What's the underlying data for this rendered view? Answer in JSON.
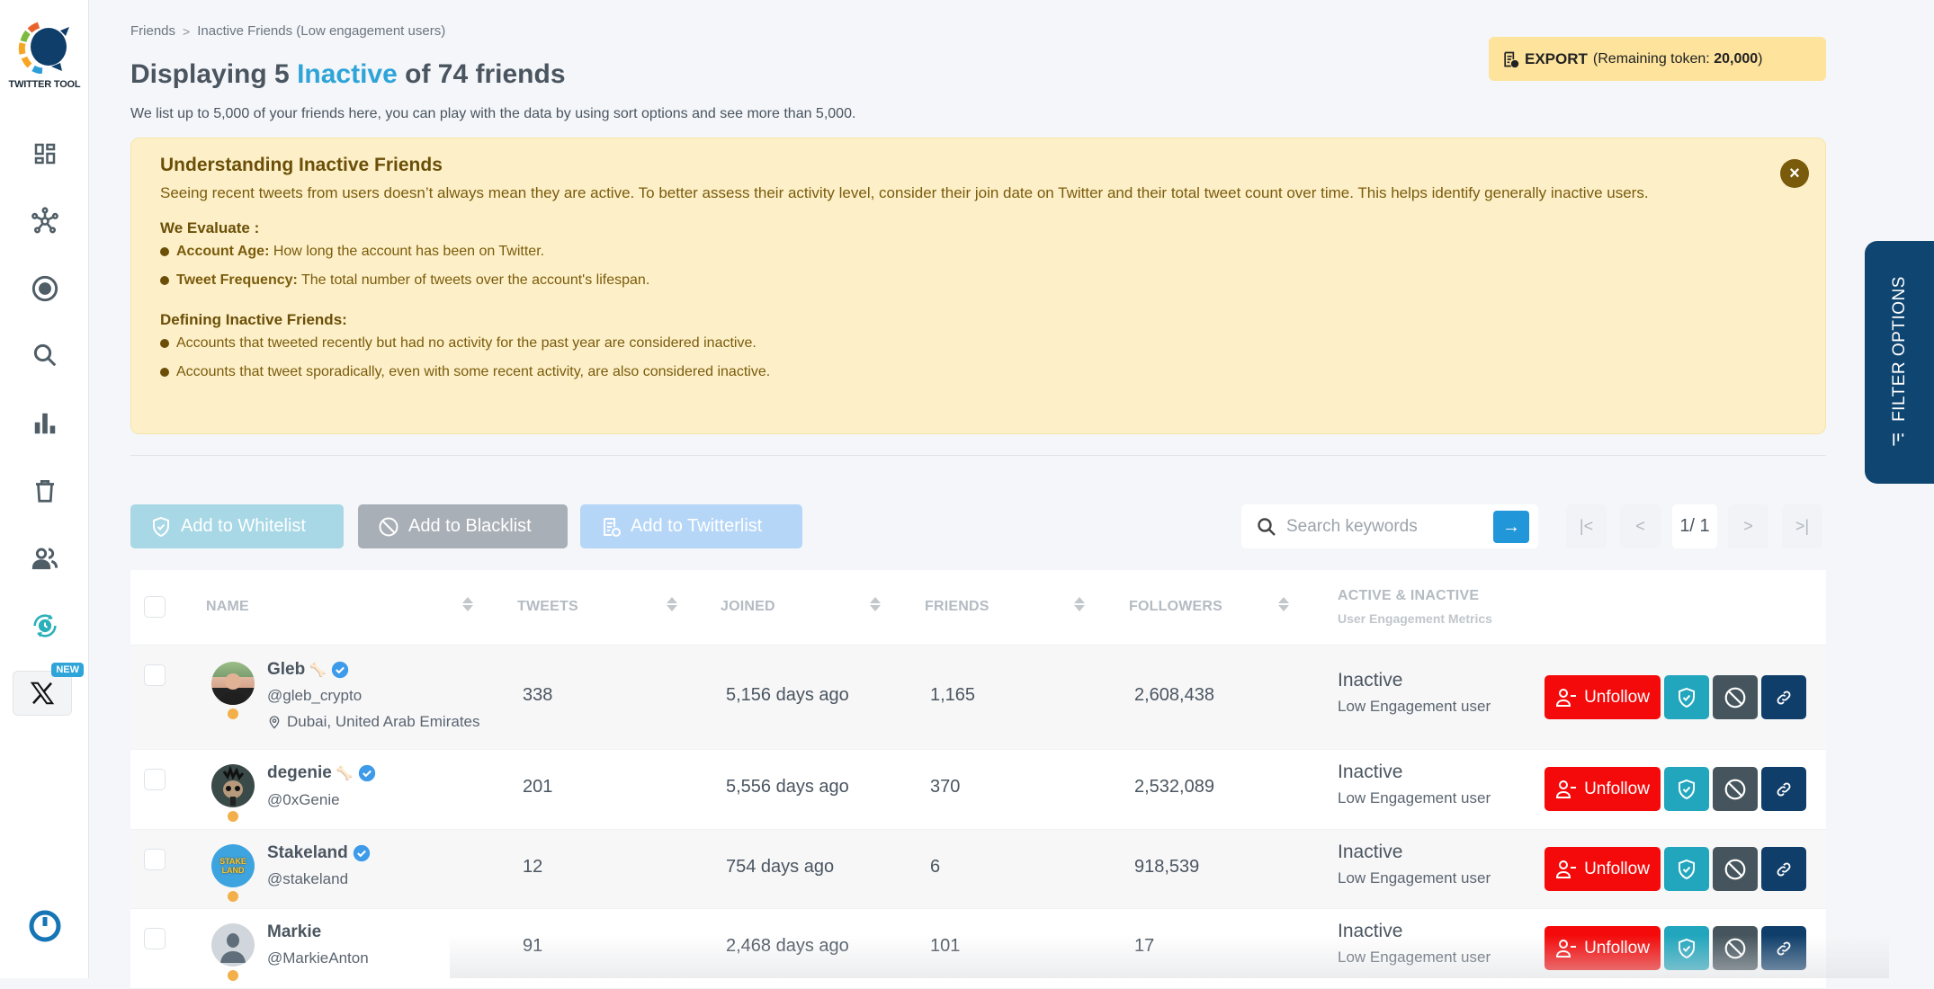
{
  "app": {
    "logo_text": "TWITTER TOOL",
    "new_badge": "NEW"
  },
  "sidebar": {
    "items": [
      {
        "name": "dashboard",
        "icon": "dashboard-icon"
      },
      {
        "name": "network",
        "icon": "network-icon"
      },
      {
        "name": "target",
        "icon": "target-icon"
      },
      {
        "name": "search",
        "icon": "search-icon"
      },
      {
        "name": "analytics",
        "icon": "bar-chart-icon"
      },
      {
        "name": "delete",
        "icon": "trash-icon"
      },
      {
        "name": "friends",
        "icon": "users-icon",
        "active": true
      },
      {
        "name": "scheduler",
        "icon": "sync-clock-icon"
      },
      {
        "name": "x",
        "icon": "x-logo-icon"
      }
    ]
  },
  "breadcrumb": {
    "items": [
      "Friends",
      "Inactive Friends (Low engagement users)"
    ],
    "separator": ">"
  },
  "header": {
    "title_prefix": "Displaying 5 ",
    "title_accent": "Inactive",
    "title_suffix": " of 74 friends",
    "subtitle": "We list up to 5,000 of your friends here, you can play with the data by using sort options and see more than 5,000.",
    "accent_color": "#2ea4d8"
  },
  "export": {
    "label": "EXPORT",
    "remaining_prefix": "(Remaining token: ",
    "remaining_value": "20,000",
    "remaining_suffix": ")"
  },
  "info": {
    "title": "Understanding Inactive Friends",
    "body": "Seeing recent tweets from users doesn’t always mean they are active. To better assess their activity level, consider their join date on Twitter and their total tweet count over time. This helps identify generally inactive users.",
    "evaluate_heading": "We Evaluate :",
    "evaluate_items": [
      {
        "label": "Account Age:",
        "text": " How long the account has been on Twitter."
      },
      {
        "label": "Tweet Frequency:",
        "text": " The total number of tweets over the account's lifespan."
      }
    ],
    "defining_heading": "Defining Inactive Friends:",
    "defining_items": [
      "Accounts that tweeted recently but had no activity for the past year are considered inactive.",
      "Accounts that tweet sporadically, even with some recent activity, are also considered inactive."
    ],
    "close_label": "×"
  },
  "bulk_actions": {
    "whitelist": "Add to Whitelist",
    "blacklist": "Add to Blacklist",
    "twitterlist": "Add to Twitterlist"
  },
  "search": {
    "placeholder": "Search keywords",
    "value": "",
    "go_label": "→"
  },
  "pagination": {
    "first": "|<",
    "prev": "<",
    "current": "1/ 1",
    "next": ">",
    "last": ">|"
  },
  "table": {
    "columns": {
      "name": "NAME",
      "tweets": "TWEETS",
      "joined": "JOINED",
      "friends": "FRIENDS",
      "followers": "FOLLOWERS",
      "engagement": "ACTIVE & INACTIVE",
      "engagement_sub": "User Engagement Metrics"
    },
    "unfollow_label": "Unfollow",
    "rows": [
      {
        "name": "Gleb",
        "handle": "@gleb_crypto",
        "location": "Dubai, United Arab Emirates",
        "bone": true,
        "verified": true,
        "tweets": "338",
        "joined": "5,156 days ago",
        "friends": "1,165",
        "followers": "2,608,438",
        "status": "Inactive",
        "status_sub": "Low Engagement user"
      },
      {
        "name": "degenie",
        "handle": "@0xGenie",
        "location": "",
        "bone": true,
        "verified": true,
        "tweets": "201",
        "joined": "5,556 days ago",
        "friends": "370",
        "followers": "2,532,089",
        "status": "Inactive",
        "status_sub": "Low Engagement user"
      },
      {
        "name": "Stakeland",
        "handle": "@stakeland",
        "location": "",
        "bone": false,
        "verified": true,
        "tweets": "12",
        "joined": "754 days ago",
        "friends": "6",
        "followers": "918,539",
        "status": "Inactive",
        "status_sub": "Low Engagement user",
        "avatar_text": "STAKE LAND"
      },
      {
        "name": "Markie",
        "handle": "@MarkieAnton",
        "location": "",
        "bone": false,
        "verified": false,
        "tweets": "91",
        "joined": "2,468 days ago",
        "friends": "101",
        "followers": "17",
        "status": "Inactive",
        "status_sub": "Low Engagement user"
      }
    ]
  },
  "filter_panel": {
    "label": "FILTER OPTIONS"
  }
}
